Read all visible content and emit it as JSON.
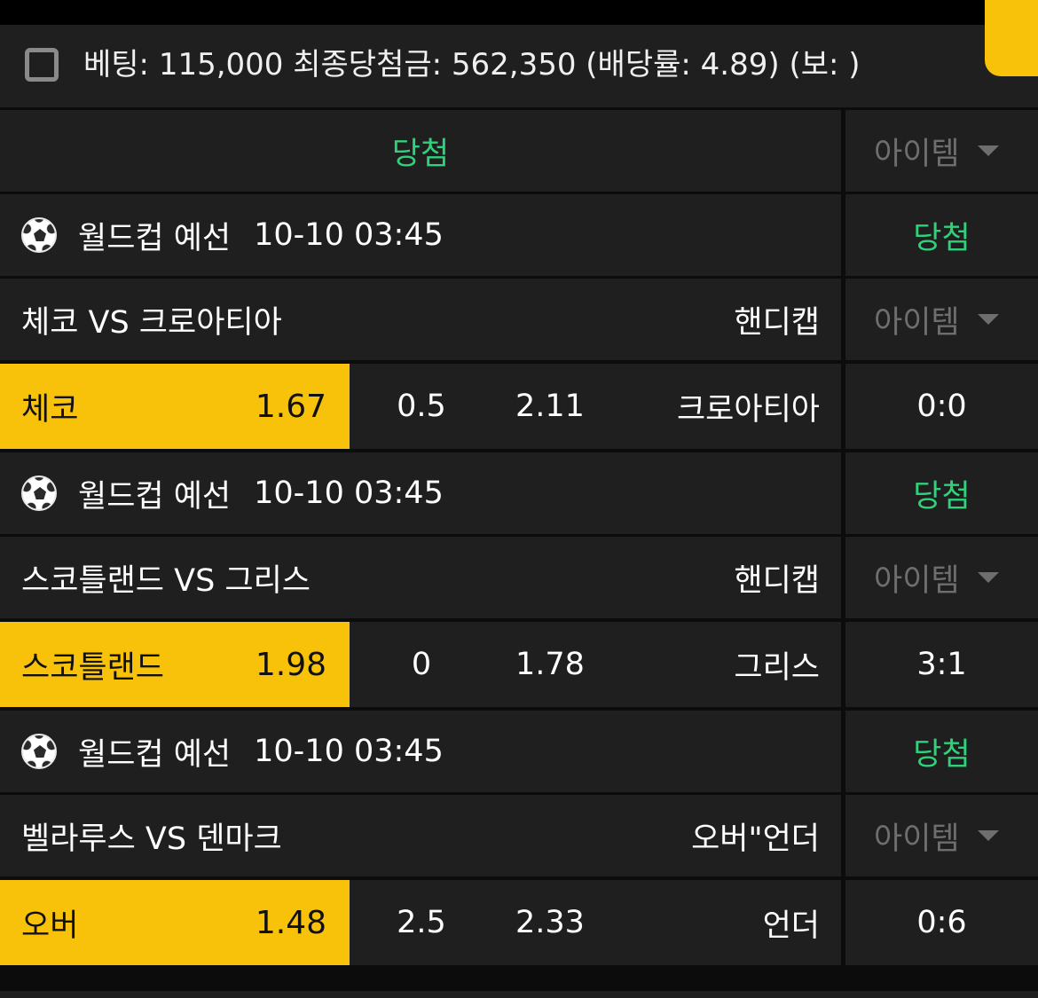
{
  "summary": {
    "text": "베팅: 115,000 최종당첨금: 562,350 (배당률: 4.89) (보: )"
  },
  "header_row": {
    "status": "당첨",
    "item_label": "아이템"
  },
  "games": [
    {
      "league": "월드컵 예선",
      "datetime": "10-10 03:45",
      "status": "당첨",
      "matchup": "체코 VS 크로아티아",
      "bet_type": "핸디캡",
      "item_label": "아이템",
      "pick_name": "체코",
      "pick_odds": "1.67",
      "line": "0.5",
      "other_odds": "2.11",
      "other_name": "크로아티아",
      "score": "0:0"
    },
    {
      "league": "월드컵 예선",
      "datetime": "10-10 03:45",
      "status": "당첨",
      "matchup": "스코틀랜드 VS 그리스",
      "bet_type": "핸디캡",
      "item_label": "아이템",
      "pick_name": "스코틀랜드",
      "pick_odds": "1.98",
      "line": "0",
      "other_odds": "1.78",
      "other_name": "그리스",
      "score": "3:1"
    },
    {
      "league": "월드컵 예선",
      "datetime": "10-10 03:45",
      "status": "당첨",
      "matchup": "벨라루스 VS 덴마크",
      "bet_type": "오버\"언더",
      "item_label": "아이템",
      "pick_name": "오버",
      "pick_odds": "1.48",
      "line": "2.5",
      "other_odds": "2.33",
      "other_name": "언더",
      "score": "0:6"
    }
  ],
  "icons": {
    "checkbox": "checkbox-unchecked-icon",
    "ball": "soccer-ball-icon",
    "dropdown": "caret-down-icon"
  },
  "colors": {
    "accent": "#f9c20a",
    "win_green": "#2fd17a",
    "row_bg": "#1f1f1f",
    "divider": "#0c0c0c",
    "muted": "#6e6e6e"
  }
}
